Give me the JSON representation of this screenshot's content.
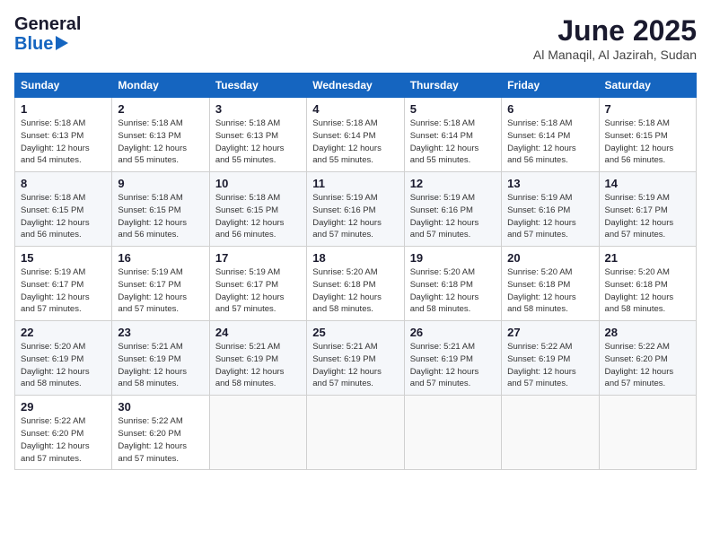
{
  "header": {
    "logo_line1": "General",
    "logo_line2": "Blue",
    "month": "June 2025",
    "location": "Al Manaqil, Al Jazirah, Sudan"
  },
  "weekdays": [
    "Sunday",
    "Monday",
    "Tuesday",
    "Wednesday",
    "Thursday",
    "Friday",
    "Saturday"
  ],
  "weeks": [
    [
      {
        "day": "1",
        "info": "Sunrise: 5:18 AM\nSunset: 6:13 PM\nDaylight: 12 hours\nand 54 minutes."
      },
      {
        "day": "2",
        "info": "Sunrise: 5:18 AM\nSunset: 6:13 PM\nDaylight: 12 hours\nand 55 minutes."
      },
      {
        "day": "3",
        "info": "Sunrise: 5:18 AM\nSunset: 6:13 PM\nDaylight: 12 hours\nand 55 minutes."
      },
      {
        "day": "4",
        "info": "Sunrise: 5:18 AM\nSunset: 6:14 PM\nDaylight: 12 hours\nand 55 minutes."
      },
      {
        "day": "5",
        "info": "Sunrise: 5:18 AM\nSunset: 6:14 PM\nDaylight: 12 hours\nand 55 minutes."
      },
      {
        "day": "6",
        "info": "Sunrise: 5:18 AM\nSunset: 6:14 PM\nDaylight: 12 hours\nand 56 minutes."
      },
      {
        "day": "7",
        "info": "Sunrise: 5:18 AM\nSunset: 6:15 PM\nDaylight: 12 hours\nand 56 minutes."
      }
    ],
    [
      {
        "day": "8",
        "info": "Sunrise: 5:18 AM\nSunset: 6:15 PM\nDaylight: 12 hours\nand 56 minutes."
      },
      {
        "day": "9",
        "info": "Sunrise: 5:18 AM\nSunset: 6:15 PM\nDaylight: 12 hours\nand 56 minutes."
      },
      {
        "day": "10",
        "info": "Sunrise: 5:18 AM\nSunset: 6:15 PM\nDaylight: 12 hours\nand 56 minutes."
      },
      {
        "day": "11",
        "info": "Sunrise: 5:19 AM\nSunset: 6:16 PM\nDaylight: 12 hours\nand 57 minutes."
      },
      {
        "day": "12",
        "info": "Sunrise: 5:19 AM\nSunset: 6:16 PM\nDaylight: 12 hours\nand 57 minutes."
      },
      {
        "day": "13",
        "info": "Sunrise: 5:19 AM\nSunset: 6:16 PM\nDaylight: 12 hours\nand 57 minutes."
      },
      {
        "day": "14",
        "info": "Sunrise: 5:19 AM\nSunset: 6:17 PM\nDaylight: 12 hours\nand 57 minutes."
      }
    ],
    [
      {
        "day": "15",
        "info": "Sunrise: 5:19 AM\nSunset: 6:17 PM\nDaylight: 12 hours\nand 57 minutes."
      },
      {
        "day": "16",
        "info": "Sunrise: 5:19 AM\nSunset: 6:17 PM\nDaylight: 12 hours\nand 57 minutes."
      },
      {
        "day": "17",
        "info": "Sunrise: 5:19 AM\nSunset: 6:17 PM\nDaylight: 12 hours\nand 57 minutes."
      },
      {
        "day": "18",
        "info": "Sunrise: 5:20 AM\nSunset: 6:18 PM\nDaylight: 12 hours\nand 58 minutes."
      },
      {
        "day": "19",
        "info": "Sunrise: 5:20 AM\nSunset: 6:18 PM\nDaylight: 12 hours\nand 58 minutes."
      },
      {
        "day": "20",
        "info": "Sunrise: 5:20 AM\nSunset: 6:18 PM\nDaylight: 12 hours\nand 58 minutes."
      },
      {
        "day": "21",
        "info": "Sunrise: 5:20 AM\nSunset: 6:18 PM\nDaylight: 12 hours\nand 58 minutes."
      }
    ],
    [
      {
        "day": "22",
        "info": "Sunrise: 5:20 AM\nSunset: 6:19 PM\nDaylight: 12 hours\nand 58 minutes."
      },
      {
        "day": "23",
        "info": "Sunrise: 5:21 AM\nSunset: 6:19 PM\nDaylight: 12 hours\nand 58 minutes."
      },
      {
        "day": "24",
        "info": "Sunrise: 5:21 AM\nSunset: 6:19 PM\nDaylight: 12 hours\nand 58 minutes."
      },
      {
        "day": "25",
        "info": "Sunrise: 5:21 AM\nSunset: 6:19 PM\nDaylight: 12 hours\nand 57 minutes."
      },
      {
        "day": "26",
        "info": "Sunrise: 5:21 AM\nSunset: 6:19 PM\nDaylight: 12 hours\nand 57 minutes."
      },
      {
        "day": "27",
        "info": "Sunrise: 5:22 AM\nSunset: 6:19 PM\nDaylight: 12 hours\nand 57 minutes."
      },
      {
        "day": "28",
        "info": "Sunrise: 5:22 AM\nSunset: 6:20 PM\nDaylight: 12 hours\nand 57 minutes."
      }
    ],
    [
      {
        "day": "29",
        "info": "Sunrise: 5:22 AM\nSunset: 6:20 PM\nDaylight: 12 hours\nand 57 minutes."
      },
      {
        "day": "30",
        "info": "Sunrise: 5:22 AM\nSunset: 6:20 PM\nDaylight: 12 hours\nand 57 minutes."
      },
      {
        "day": "",
        "info": ""
      },
      {
        "day": "",
        "info": ""
      },
      {
        "day": "",
        "info": ""
      },
      {
        "day": "",
        "info": ""
      },
      {
        "day": "",
        "info": ""
      }
    ]
  ]
}
